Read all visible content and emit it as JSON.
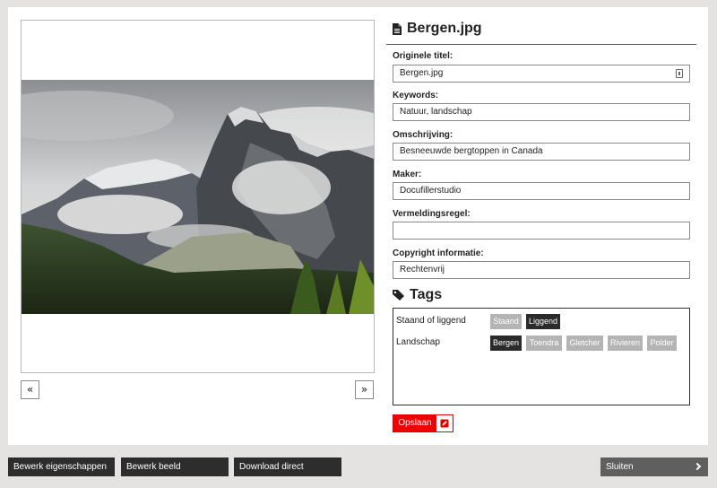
{
  "file": {
    "title": "Bergen.jpg",
    "icon": "file-icon"
  },
  "fields": [
    {
      "label": "Originele titel:",
      "value": "Bergen.jpg"
    },
    {
      "label": "Keywords:",
      "value": "Natuur, landschap"
    },
    {
      "label": "Omschrijving:",
      "value": "Besneeuwde bergtoppen in Canada"
    },
    {
      "label": "Maker:",
      "value": "Docufillerstudio"
    },
    {
      "label": "Vermeldingsregel:",
      "value": ""
    },
    {
      "label": "Copyright informatie:",
      "value": "Rechtenvrij"
    }
  ],
  "tags": {
    "title": "Tags",
    "icon": "tag-icon",
    "groups": [
      {
        "label": "Staand of liggend",
        "options": [
          {
            "label": "Staand",
            "selected": false
          },
          {
            "label": "Liggend",
            "selected": true
          }
        ]
      },
      {
        "label": "Landschap",
        "options": [
          {
            "label": "Bergen",
            "selected": true
          },
          {
            "label": "Toendra",
            "selected": false
          },
          {
            "label": "Gletcher",
            "selected": false
          },
          {
            "label": "Rivieren",
            "selected": false
          },
          {
            "label": "Polder",
            "selected": false
          }
        ]
      }
    ]
  },
  "save_button": {
    "label": "Opslaan",
    "icon": "edit-icon"
  },
  "navigation": {
    "prev_label": "«",
    "next_label": "»"
  },
  "bottom_bar": {
    "edit_properties": "Bewerk eigenschappen",
    "edit_image": "Bewerk beeld",
    "download": "Download direct",
    "close": "Sluiten"
  },
  "colors": {
    "accent": "#f00000",
    "tag_selected": "#2b2b2b",
    "tag_unselected": "#b4b4b4",
    "button_dark": "#2d2d2d"
  }
}
